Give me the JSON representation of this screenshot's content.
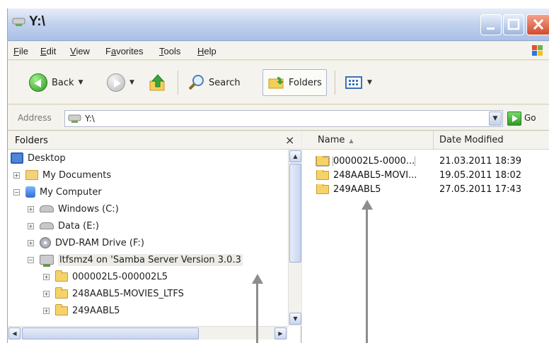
{
  "window": {
    "title": "Y:\\"
  },
  "menu": {
    "items": [
      {
        "key": "F",
        "rest": "ile"
      },
      {
        "key": "E",
        "rest": "dit"
      },
      {
        "key": "V",
        "rest": "iew"
      },
      {
        "pre": "F",
        "key": "a",
        "rest": "vorites"
      },
      {
        "key": "T",
        "rest": "ools"
      },
      {
        "key": "H",
        "rest": "elp"
      }
    ]
  },
  "toolbar": {
    "back_label": "Back",
    "search_label": "Search",
    "folders_label": "Folders"
  },
  "address": {
    "label": "Address",
    "value": "Y:\\",
    "go_label": "Go"
  },
  "folders_pane": {
    "title": "Folders",
    "close_glyph": "×",
    "tree": [
      {
        "label": "Desktop",
        "icon": "desktop-icon",
        "expander": ""
      },
      {
        "label": "My Documents",
        "icon": "folder-icon",
        "expander": "+"
      },
      {
        "label": "My Computer",
        "icon": "computer-icon",
        "expander": "−"
      },
      {
        "label": "Windows (C:)",
        "icon": "drive-icon",
        "expander": "+"
      },
      {
        "label": "Data (E:)",
        "icon": "drive-icon",
        "expander": "+"
      },
      {
        "label": "DVD-RAM Drive (F:)",
        "icon": "dvd-icon",
        "expander": "+"
      },
      {
        "label": "ltfsmz4 on 'Samba Server Version 3.0.3",
        "icon": "network-drive-icon",
        "expander": "−"
      },
      {
        "label": "000002L5-000002L5",
        "icon": "folder-icon",
        "expander": "+"
      },
      {
        "label": "248AABL5-MOVIES_LTFS",
        "icon": "folder-icon",
        "expander": "+"
      },
      {
        "label": "249AABL5",
        "icon": "folder-icon",
        "expander": "+"
      }
    ]
  },
  "files": {
    "columns": {
      "name": "Name",
      "date": "Date Modified"
    },
    "rows": [
      {
        "name": "000002L5-0000...",
        "date": "21.03.2011 18:39"
      },
      {
        "name": "248AABL5-MOVI...",
        "date": "19.05.2011 18:02"
      },
      {
        "name": "249AABL5",
        "date": "27.05.2011 17:43"
      }
    ]
  }
}
